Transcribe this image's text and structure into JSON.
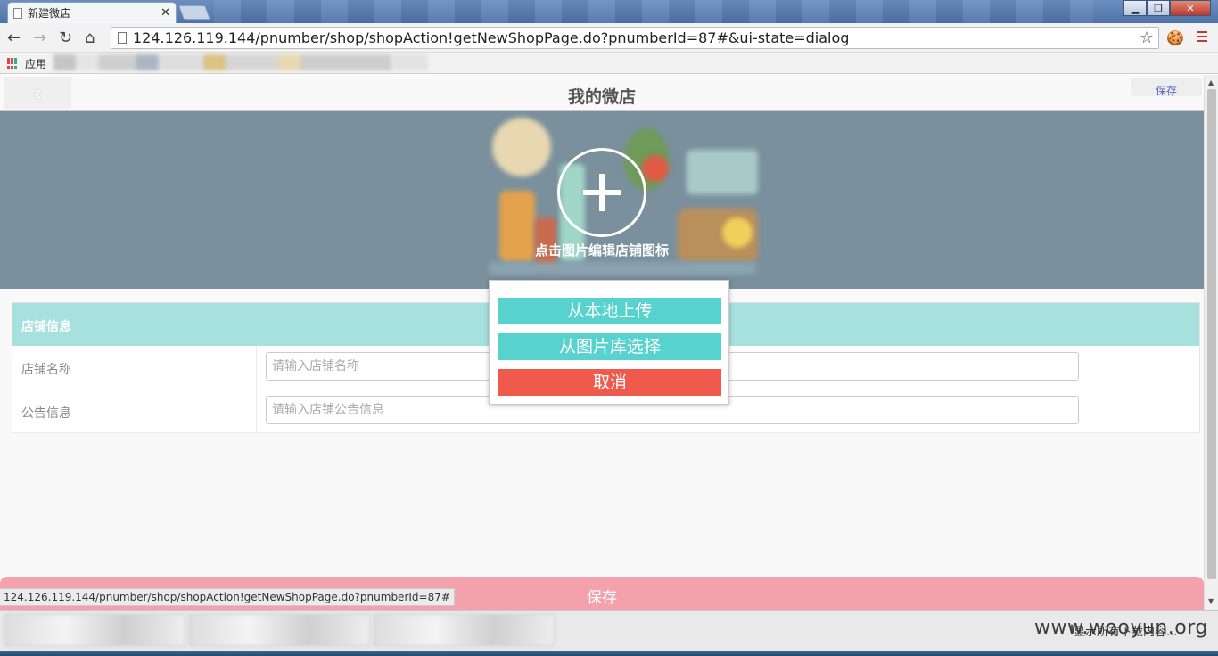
{
  "browser": {
    "tab_title": "新建微店",
    "tab_close": "✕",
    "url": "124.126.119.144/pnumber/shop/shopAction!getNewShopPage.do?pnumberId=87#&ui-state=dialog",
    "bookmarks_apps_label": "应用",
    "window_controls": {
      "minimize": "▁",
      "maximize": "❐",
      "close": "✕"
    },
    "icons": {
      "back": "←",
      "forward": "→",
      "reload": "↻",
      "home": "⌂",
      "star": "☆",
      "cookie": "🍪"
    }
  },
  "app": {
    "back_glyph": "‹",
    "title": "我的微店",
    "save_top": "保存",
    "banner_hint": "点击图片编辑店铺图标",
    "info": {
      "header": "店铺信息",
      "shop_name_label": "店铺名称",
      "shop_name_placeholder": "请输入店铺名称",
      "notice_label": "公告信息",
      "notice_placeholder": "请输入店铺公告信息"
    },
    "save_bottom": "保存"
  },
  "dialog": {
    "upload_local": "从本地上传",
    "choose_gallery": "从图片库选择",
    "cancel": "取消"
  },
  "status_bar_url": "124.126.119.144/pnumber/shop/shopAction!getNewShopPage.do?pnumberId=87#",
  "download_bar": {
    "show_all": "显示所有下载内容..."
  },
  "watermark": "www.wooyun.org",
  "colors": {
    "teal": "#58d2cf",
    "red": "#ef5a4c",
    "panel_header": "#a6e1de",
    "save_bar": "#f3a2ad",
    "banner": "#7a909d"
  }
}
